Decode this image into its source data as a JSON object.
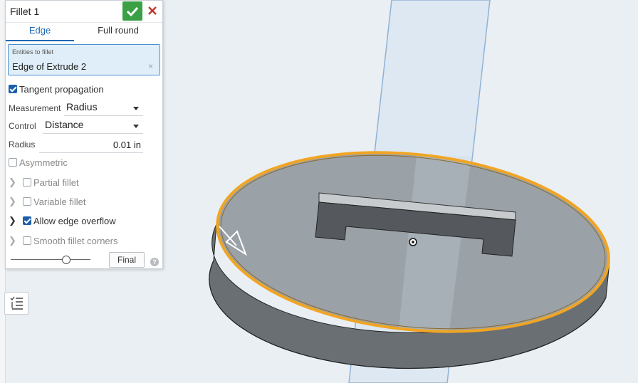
{
  "panel": {
    "title": "Fillet 1",
    "confirm_icon": "checkmark-icon",
    "cancel_icon": "close-icon",
    "tabs": [
      {
        "label": "Edge",
        "active": true
      },
      {
        "label": "Full round",
        "active": false
      }
    ],
    "entities": {
      "label": "Entities to fillet",
      "value": "Edge of Extrude 2",
      "clear_icon": "clear-icon"
    },
    "tangent_propagation": {
      "label": "Tangent propagation",
      "checked": true
    },
    "measurement": {
      "label": "Measurement",
      "value": "Radius"
    },
    "control": {
      "label": "Control",
      "value": "Distance"
    },
    "radius": {
      "label": "Radius",
      "value": "0.01 in"
    },
    "asymmetric": {
      "label": "Asymmetric",
      "checked": false
    },
    "partial_fillet": {
      "label": "Partial fillet",
      "checked": false
    },
    "variable_fillet": {
      "label": "Variable fillet",
      "checked": false
    },
    "allow_edge_overflow": {
      "label": "Allow edge overflow",
      "checked": true
    },
    "smooth_fillet_corners": {
      "label": "Smooth fillet corners",
      "checked": false
    },
    "slider": {
      "level": 0.7
    },
    "final_label": "Final",
    "help_label": "?"
  },
  "colors": {
    "accent": "#1c67b3",
    "confirm_green": "#3aa046",
    "cancel_red": "#c0392b",
    "selection_orange": "#f0a524",
    "background": "#eaeff3"
  },
  "side_toolbar": {
    "icon": "feature-list-icon"
  }
}
